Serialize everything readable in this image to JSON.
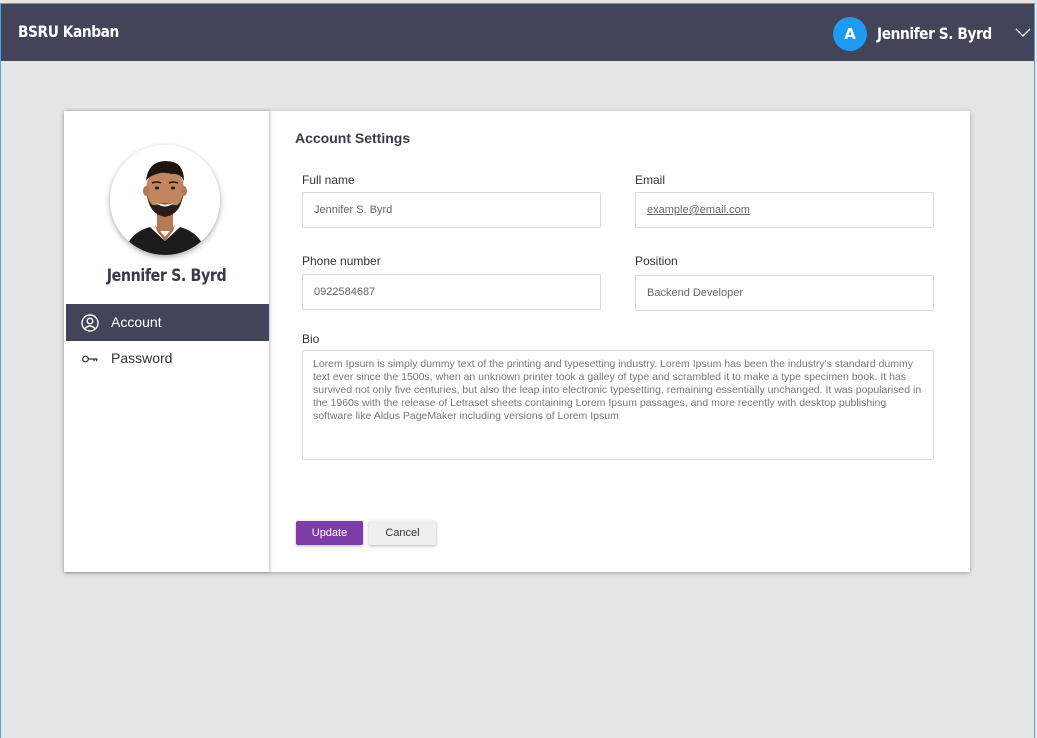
{
  "app": {
    "title": "BSRU Kanban"
  },
  "user": {
    "initial": "A",
    "name": "Jennifer S. Byrd"
  },
  "profile": {
    "name": "Jennifer S. Byrd"
  },
  "nav": {
    "items": [
      {
        "label": "Account",
        "icon": "user-circle-icon",
        "active": true
      },
      {
        "label": "Password",
        "icon": "key-icon",
        "active": false
      }
    ]
  },
  "settings": {
    "title": "Account Settings",
    "full_name": {
      "label": "Full name",
      "value": "Jennifer S. Byrd"
    },
    "email": {
      "label": "Email",
      "value": "example@email.com"
    },
    "phone": {
      "label": "Phone number",
      "value": "0922584687"
    },
    "position": {
      "label": "Position",
      "value": "Backend Developer"
    },
    "bio": {
      "label": "Bio",
      "value": "Lorem Ipsum is simply dummy text of the printing and typesetting industry. Lorem Ipsum has been the industry's standard dummy text ever since the 1500s, when an unknown printer took a galley of type and scrambled it to make a type specimen book. It has survived not only five centuries, but also the leap into electronic typesetting, remaining essentially unchanged. It was popularised in the 1960s with the release of Letraset sheets containing Lorem Ipsum passages, and more recently with desktop publishing software like Aldus PageMaker including versions of Lorem Ipsum"
    }
  },
  "actions": {
    "update_label": "Update",
    "cancel_label": "Cancel"
  },
  "colors": {
    "header": "#434359",
    "accent": "#7e3ca6",
    "avatar": "#1e9bf0"
  }
}
